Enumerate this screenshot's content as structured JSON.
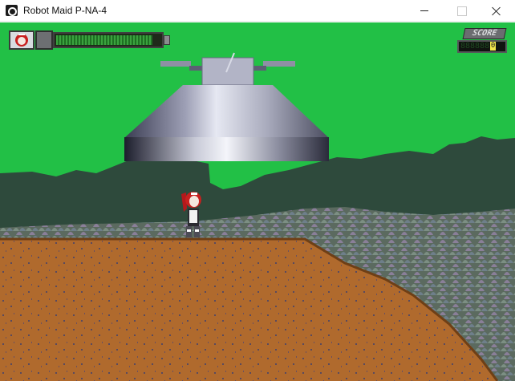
{
  "window": {
    "title": "Robot Maid P-NA-4"
  },
  "hud": {
    "health_fraction": 0.92,
    "score_label": "SCORE",
    "score_digits": "888888",
    "score_value": "0"
  },
  "colors": {
    "sky": "#22c046",
    "bar_green": "#3aa23e",
    "ground": "#b06a2d",
    "mountains": "#2e4a3c",
    "score_highlight": "#f1e64b"
  }
}
